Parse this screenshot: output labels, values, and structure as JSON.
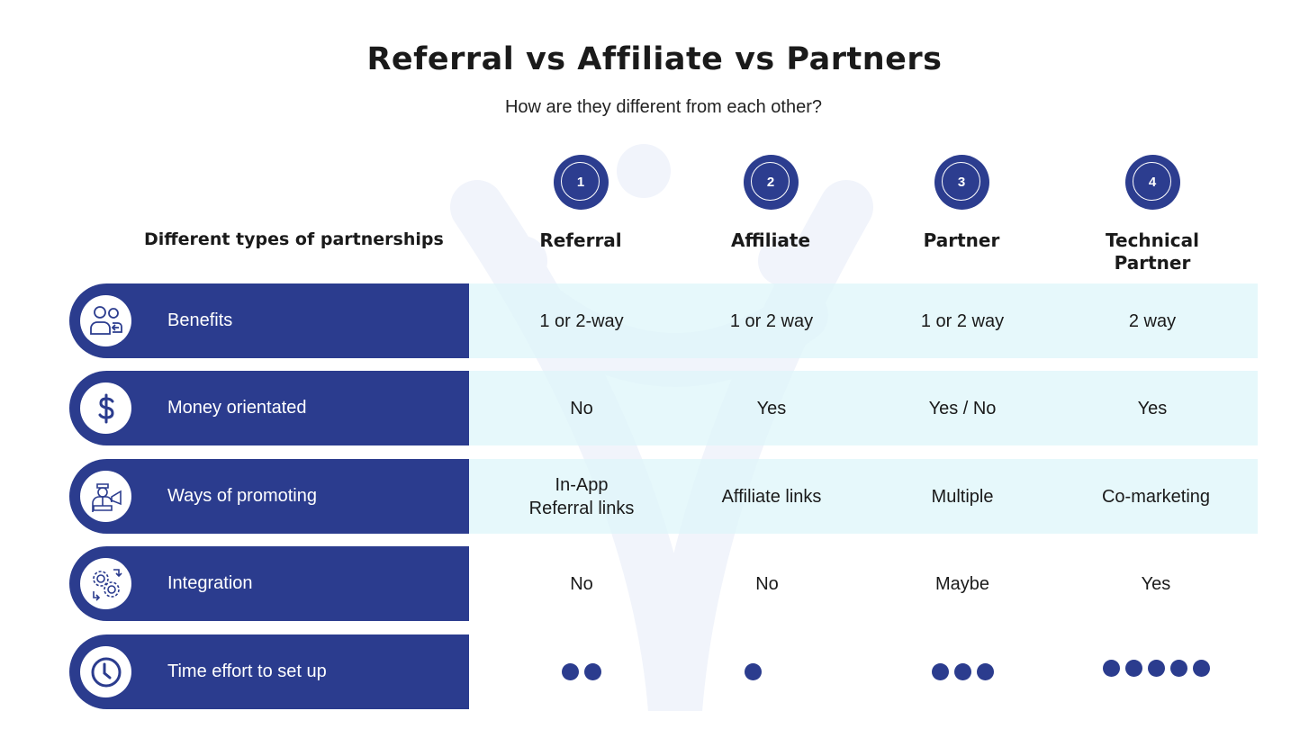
{
  "header": {
    "title": "Referral vs Affiliate vs Partners",
    "subtitle": "How are they different from each other?"
  },
  "table": {
    "row_header_label": "Different types of partnerships",
    "columns": [
      {
        "number": "1",
        "label": "Referral"
      },
      {
        "number": "2",
        "label": "Affiliate"
      },
      {
        "number": "3",
        "label": "Partner"
      },
      {
        "number": "4",
        "label": "Technical Partner"
      }
    ],
    "rows": [
      {
        "label": "Benefits",
        "icon": "people-exchange-icon",
        "values": [
          "1 or 2-way",
          "1 or 2 way",
          "1 or 2 way",
          "2 way"
        ]
      },
      {
        "label": "Money orientated",
        "icon": "dollar-icon",
        "values": [
          "No",
          "Yes",
          "Yes / No",
          "Yes"
        ]
      },
      {
        "label": "Ways of promoting",
        "icon": "promoter-megaphone-icon",
        "values": [
          "In-App\nReferral links",
          "Affiliate links",
          "Multiple",
          "Co-marketing"
        ]
      },
      {
        "label": "Integration",
        "icon": "gears-sync-icon",
        "values": [
          "No",
          "No",
          "Maybe",
          "Yes"
        ]
      },
      {
        "label": "Time effort to set up",
        "icon": "clock-icon",
        "dots": [
          2,
          1,
          3,
          5
        ],
        "dots_max": 5
      }
    ]
  },
  "colors": {
    "primary": "#2b3c8e",
    "row_tint": "#e3f7fa",
    "text": "#1a1a1a"
  }
}
